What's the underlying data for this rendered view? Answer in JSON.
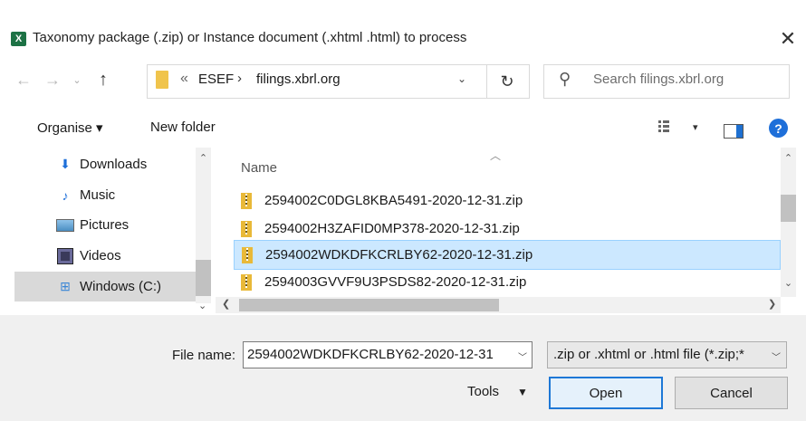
{
  "window": {
    "title": "Taxonomy package (.zip) or Instance document (.xhtml .html) to process",
    "app_icon_letter": "X",
    "close_glyph": "✕"
  },
  "address": {
    "chevron": "«",
    "segments": [
      "ESEF",
      "filings.xbrl.org"
    ],
    "separator": "›",
    "dropdown_glyph": "⌄",
    "refresh_glyph": "↻"
  },
  "search": {
    "placeholder": "Search filings.xbrl.org",
    "icon": "search-icon"
  },
  "toolbar": {
    "organise_label": "Organise ▾",
    "new_folder_label": "New folder",
    "help_glyph": "?",
    "view_chevron": "▾"
  },
  "nav_pane": {
    "items": [
      {
        "label": "Downloads",
        "icon": "download-icon"
      },
      {
        "label": "Music",
        "icon": "music-icon"
      },
      {
        "label": "Pictures",
        "icon": "pictures-icon"
      },
      {
        "label": "Videos",
        "icon": "videos-icon"
      },
      {
        "label": "Windows (C:)",
        "icon": "drive-icon",
        "selected": true
      }
    ]
  },
  "file_list": {
    "column_name": "Name",
    "files": [
      {
        "name": "2594002C0DGL8KBA5491-2020-12-31.zip",
        "selected": false
      },
      {
        "name": "2594002H3ZAFID0MP378-2020-12-31.zip",
        "selected": false
      },
      {
        "name": "2594002WDKDFKCRLBY62-2020-12-31.zip",
        "selected": true
      },
      {
        "name": "2594003GVVF9U3PSDS82-2020-12-31.zip",
        "selected": false
      }
    ]
  },
  "bottom": {
    "file_name_label": "File name:",
    "file_name_value": "2594002WDKDFKCRLBY62-2020-12-31",
    "filter_value": ".zip or .xhtml or .html file (*.zip;*",
    "tools_label": "Tools",
    "open_label": "Open",
    "cancel_label": "Cancel"
  },
  "colors": {
    "selection": "#cce8ff",
    "accent": "#1e78d6"
  }
}
